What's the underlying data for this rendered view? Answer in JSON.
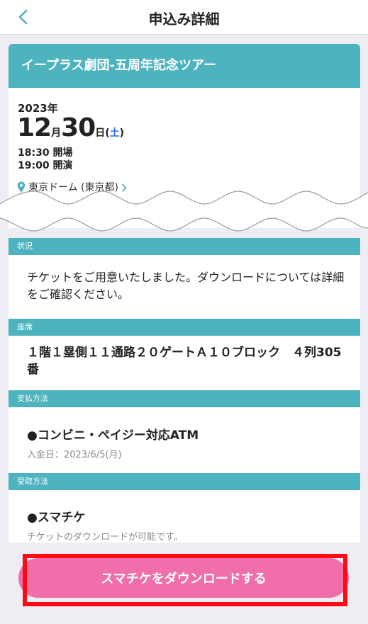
{
  "header": {
    "title": "申込み詳細",
    "back_icon": "chevron-left-icon"
  },
  "event": {
    "title": "イープラス劇団-五周年記念ツアー",
    "year": "2023年",
    "month": "12",
    "month_unit": "月",
    "day": "30",
    "day_unit": "日",
    "paren_open": "(",
    "weekday": "土",
    "paren_close": ")",
    "open_time": "18:30 開場",
    "start_time": "19:00 開演",
    "venue": "東京ドーム (東京都)",
    "venue_icon": "map-pin-icon"
  },
  "status": {
    "label": "状況",
    "text": "チケットをご用意いたしました。ダウンロードについては詳細をご確認ください。"
  },
  "seat": {
    "label": "座席",
    "text": "１階１塁側１１通路２０ゲートＡ１０ブロック　４列305番"
  },
  "payment": {
    "label": "支払方法",
    "method": "●コンビニ・ペイジー対応ATM",
    "sub": "入金日：2023/6/5(月)"
  },
  "receive": {
    "label": "受取方法",
    "method": "●スマチケ",
    "sub": "チケットのダウンロードが可能です。"
  },
  "action": {
    "download_label": "スマチケをダウンロードする"
  },
  "colors": {
    "accent": "#4cb3bf",
    "button": "#f06ea9",
    "weekday": "#2b6dd8",
    "highlight": "#ff0a14"
  }
}
